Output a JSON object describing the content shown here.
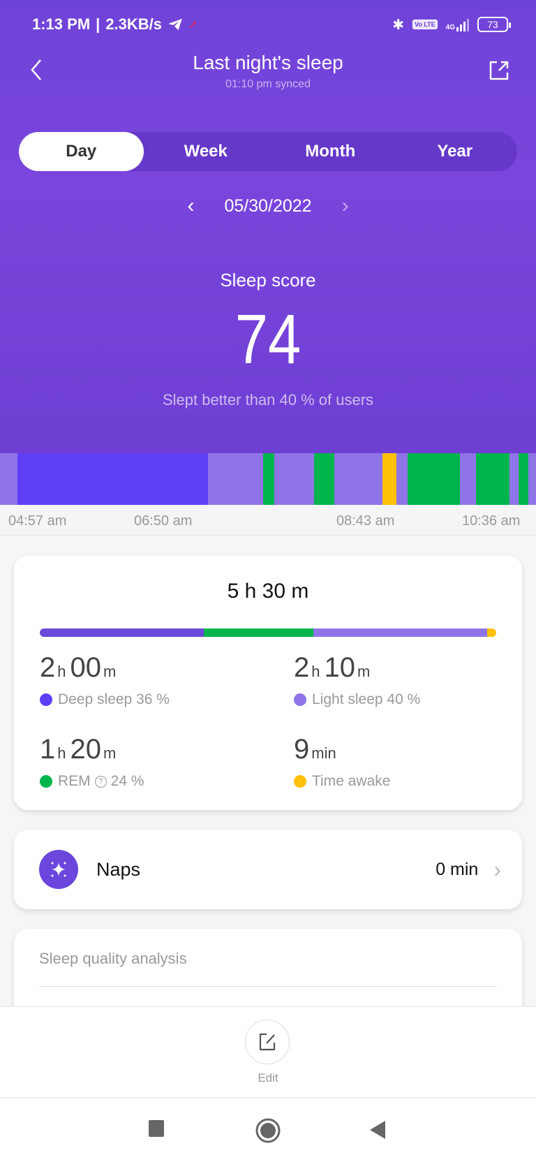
{
  "status_bar": {
    "time": "1:13 PM",
    "net_speed": "2.3KB/s",
    "network": "4G",
    "volte": "Vo LTE",
    "battery": "73"
  },
  "header": {
    "title": "Last night's sleep",
    "synced": "01:10 pm synced"
  },
  "tabs": [
    {
      "label": "Day",
      "active": true
    },
    {
      "label": "Week",
      "active": false
    },
    {
      "label": "Month",
      "active": false
    },
    {
      "label": "Year",
      "active": false
    }
  ],
  "date": {
    "prev": "‹",
    "value": "05/30/2022",
    "next": "›"
  },
  "score": {
    "label": "Sleep score",
    "value": "74",
    "comparison": "Slept better than 40 % of users"
  },
  "colors": {
    "deep": "#5e3ff5",
    "light": "#8f74e8",
    "rem": "#00b54c",
    "awake": "#ffc107",
    "accent": "#7043d8"
  },
  "timeline": {
    "axis_labels": [
      "04:57 am",
      "06:50 am",
      "08:43 am",
      "10:36 am"
    ],
    "segments": [
      {
        "stage": "light",
        "start": 0.0,
        "end": 0.033
      },
      {
        "stage": "deep",
        "start": 0.033,
        "end": 0.388
      },
      {
        "stage": "light",
        "start": 0.388,
        "end": 0.491
      },
      {
        "stage": "rem",
        "start": 0.491,
        "end": 0.512
      },
      {
        "stage": "light",
        "start": 0.512,
        "end": 0.586
      },
      {
        "stage": "rem",
        "start": 0.586,
        "end": 0.624
      },
      {
        "stage": "light",
        "start": 0.624,
        "end": 0.714
      },
      {
        "stage": "awake",
        "start": 0.714,
        "end": 0.74
      },
      {
        "stage": "light",
        "start": 0.74,
        "end": 0.76
      },
      {
        "stage": "rem",
        "start": 0.76,
        "end": 0.858
      },
      {
        "stage": "light",
        "start": 0.858,
        "end": 0.888
      },
      {
        "stage": "rem",
        "start": 0.888,
        "end": 0.951
      },
      {
        "stage": "light",
        "start": 0.951,
        "end": 0.967
      },
      {
        "stage": "rem",
        "start": 0.967,
        "end": 0.986
      },
      {
        "stage": "light",
        "start": 0.986,
        "end": 1.0
      }
    ]
  },
  "summary": {
    "total": "5 h 30 m",
    "breakdown": [
      {
        "stage": "deep",
        "fraction": 0.36
      },
      {
        "stage": "rem",
        "fraction": 0.24
      },
      {
        "stage": "light",
        "fraction": 0.38
      },
      {
        "stage": "awake",
        "fraction": 0.02
      }
    ],
    "stats": {
      "deep": {
        "hours": "2",
        "h_unit": "h",
        "minutes": "00",
        "m_unit": "m",
        "label": "Deep sleep 36 %"
      },
      "light": {
        "hours": "2",
        "h_unit": "h",
        "minutes": "10",
        "m_unit": "m",
        "label": "Light sleep 40 %"
      },
      "rem": {
        "hours": "1",
        "h_unit": "h",
        "minutes": "20",
        "m_unit": "m",
        "label": "REM",
        "help": "?",
        "pct": "24 %"
      },
      "awake": {
        "minutes": "9",
        "unit": "min",
        "label": "Time awake"
      }
    }
  },
  "naps": {
    "label": "Naps",
    "value": "0 min"
  },
  "quality": {
    "title": "Sleep quality analysis"
  },
  "bottom": {
    "edit_label": "Edit"
  }
}
